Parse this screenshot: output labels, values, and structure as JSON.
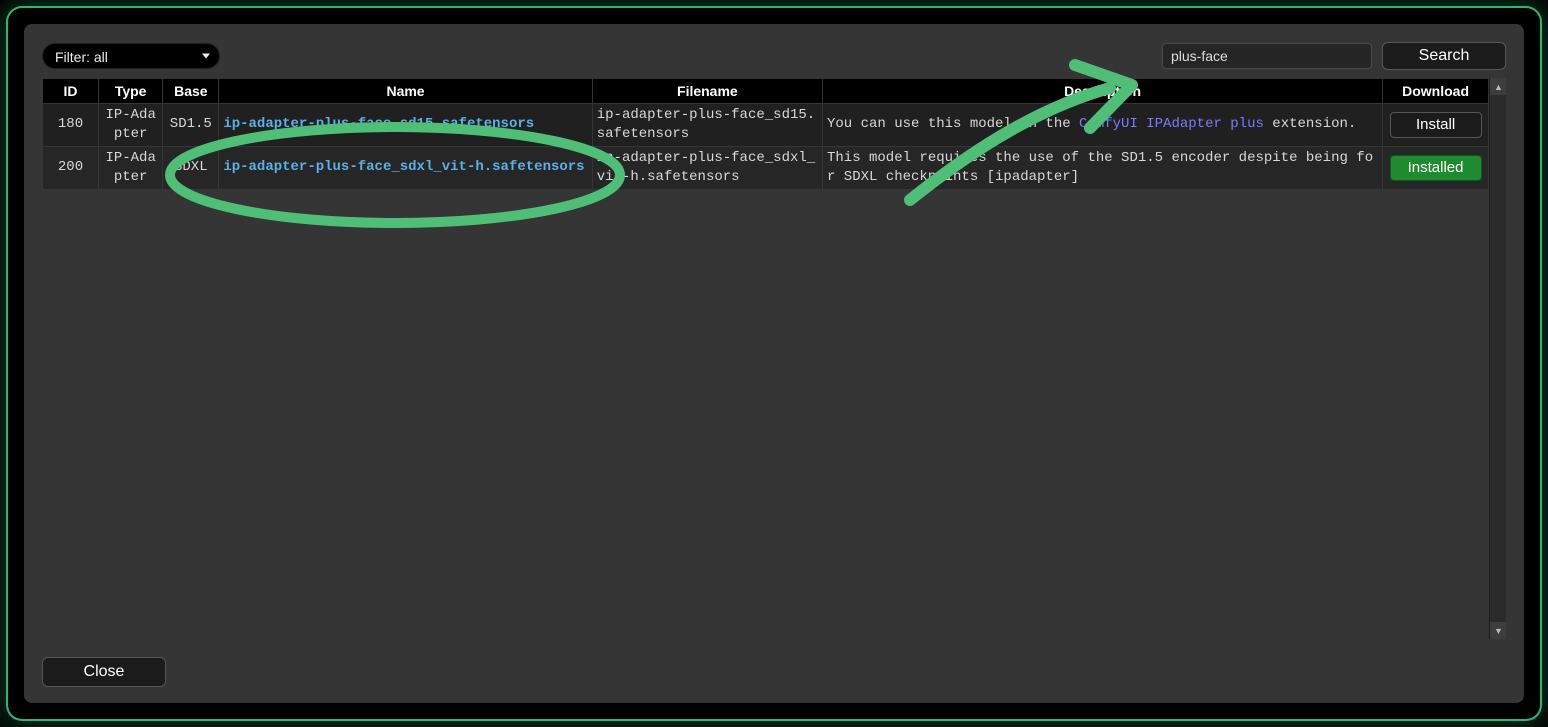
{
  "toolbar": {
    "filter_label": "Filter: all",
    "search_value": "plus-face",
    "search_button": "Search"
  },
  "columns": {
    "id": "ID",
    "type": "Type",
    "base": "Base",
    "name": "Name",
    "filename": "Filename",
    "description": "Description",
    "download": "Download"
  },
  "rows": [
    {
      "id": "180",
      "type": "IP-Adapter",
      "base": "SD1.5",
      "name": "ip-adapter-plus-face_sd15.safetensors",
      "filename": "ip-adapter-plus-face_sd15.safetensors",
      "desc_pre": "You can use this model in the ",
      "desc_link": "ComfyUI IPAdapter plus",
      "desc_post": " extension.",
      "button": "Install",
      "installed": false
    },
    {
      "id": "200",
      "type": "IP-Adapter",
      "base": "SDXL",
      "name": "ip-adapter-plus-face_sdxl_vit-h.safetensors",
      "filename": "ip-adapter-plus-face_sdxl_vit-h.safetensors",
      "desc_pre": "This model requires the use of the SD1.5 encoder despite being for SDXL checkpoints [ipadapter]",
      "desc_link": "",
      "desc_post": "",
      "button": "Installed",
      "installed": true
    }
  ],
  "footer": {
    "close": "Close"
  }
}
